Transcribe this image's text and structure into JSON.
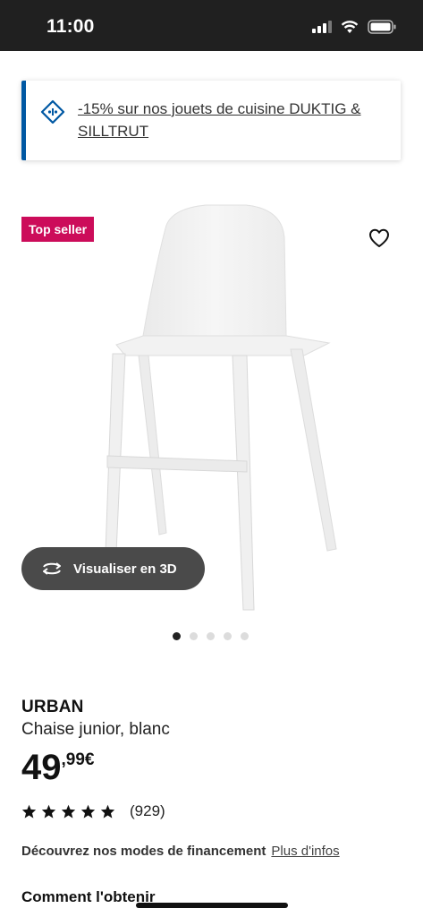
{
  "status_bar": {
    "time": "11:00"
  },
  "promo": {
    "text": "-15% sur nos jouets de cuisine DUKTIG & SILLTRUT"
  },
  "product": {
    "badge": "Top seller",
    "name": "URBAN",
    "description": "Chaise junior, blanc",
    "price_integer": "49",
    "price_decimal": ",99€",
    "rating_count": "(929)",
    "rating_stars": 5,
    "image_total": 5,
    "image_index": 1
  },
  "viewer": {
    "button_label": "Visualiser en 3D"
  },
  "financing": {
    "label": "Découvrez nos modes de financement",
    "link": "Plus d'infos"
  },
  "section": {
    "get_it_title": "Comment l'obtenir"
  },
  "colors": {
    "badge": "#cc0c5a",
    "accent": "#0058a3",
    "status_bar": "#202020"
  }
}
